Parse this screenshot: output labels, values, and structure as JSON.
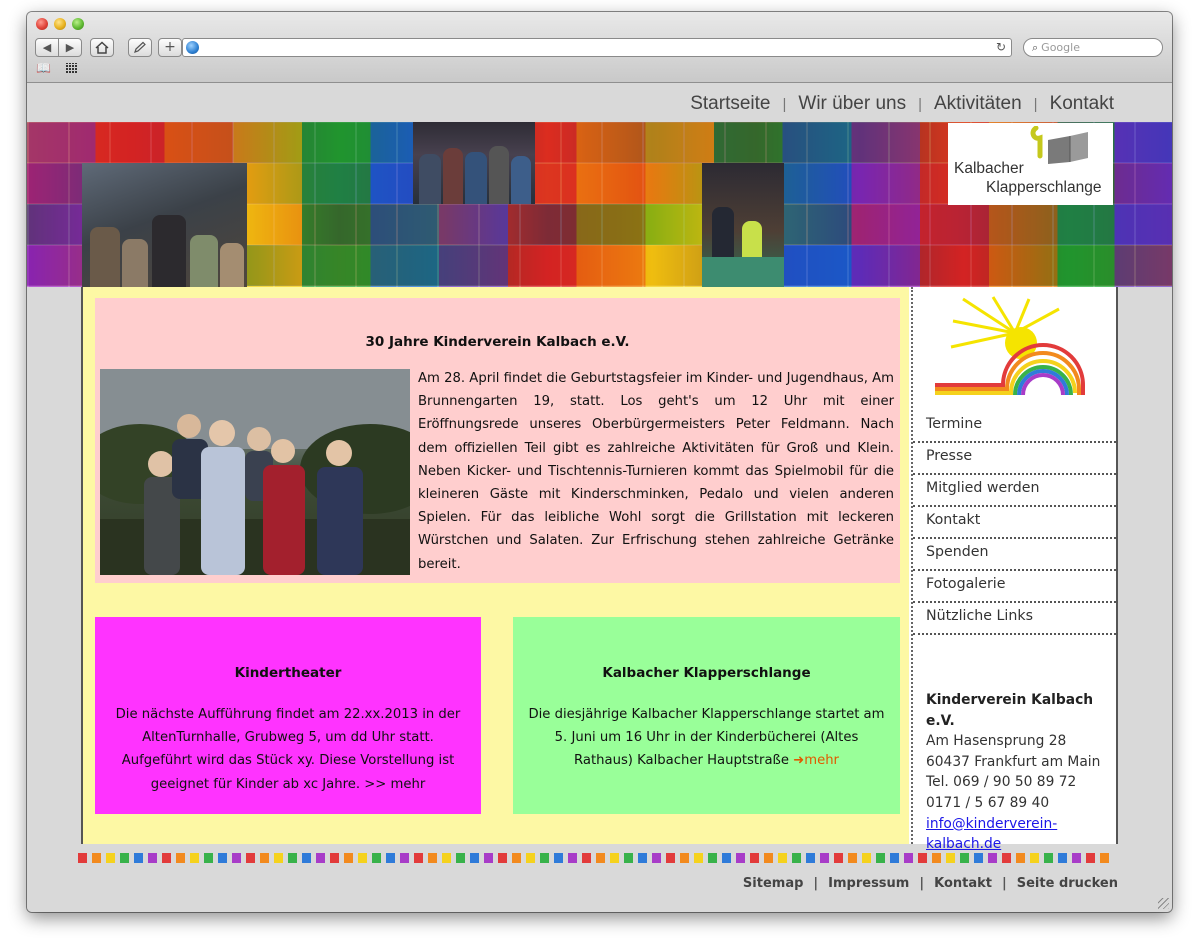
{
  "browser": {
    "url": "",
    "search_placeholder": "Google",
    "buttons": {
      "back": "◀",
      "forward": "▶",
      "add": "+"
    }
  },
  "topnav": {
    "items": [
      "Startseite",
      "Wir über uns",
      "Aktivitäten",
      "Kontakt"
    ],
    "separator": "|"
  },
  "banner": {
    "logo_line1": "Kalbacher",
    "logo_line2": "Klapperschlange"
  },
  "feature": {
    "title": "30 Jahre Kinderverein Kalbach e.V.",
    "text": "Am 28. April findet die Geburtstagsfeier im Kinder- und Jugendhaus, Am Brunnengarten 19, statt. Los geht's um 12 Uhr mit einer Eröffnungsrede unseres Oberbürgermeisters Peter Feldmann. Nach dem offiziellen Teil gibt es zahlreiche Aktivitäten für Groß und Klein. Neben Kicker- und Tischtennis-Turnieren kommt das Spielmobil für die kleineren Gäste mit Kinderschminken, Pedalo und vielen anderen Spielen. Für das leibliche Wohl sorgt die Grillstation mit leckeren Würstchen und Salaten. Zur Erfrischung stehen zahlreiche Getränke bereit."
  },
  "boxes": {
    "theater": {
      "title": "Kindertheater",
      "text": "Die nächste Aufführung findet am 22.xx.2013 in der AltenTurnhalle, Grubweg 5, um dd Uhr statt. Aufgeführt wird das Stück xy. Diese Vorstellung ist geeignet für Kinder ab xc Jahre. >> mehr",
      "color": "#ff33ff"
    },
    "snake": {
      "title": "Kalbacher Klapperschlange",
      "text": "Die diesjährige Kalbacher Klapperschlange startet am 5. Juni um 16 Uhr in der Kinderbücherei (Altes Rathaus) Kalbacher Hauptstraße",
      "more": "mehr",
      "color": "#99ff99"
    }
  },
  "sidebar": {
    "nav": [
      "Termine",
      "Presse",
      "Mitglied werden",
      "Kontakt",
      "Spenden",
      "Fotogalerie",
      "Nützliche Links"
    ],
    "address": {
      "org": "Kinderverein Kalbach e.V.",
      "street": "Am Hasensprung 28",
      "city": "60437 Frankfurt am Main",
      "tel": "Tel. 069 / 90 50 89 72",
      "mobile": "0171 / 5 67 89 40",
      "email_line1": "info@kinderverein-",
      "email_line2": "kalbach.de"
    }
  },
  "footer": {
    "links": [
      "Sitemap",
      "Impressum",
      "Kontakt",
      "Seite drucken"
    ],
    "separator": "|"
  },
  "colors": {
    "page_bg": "#d9d9d9",
    "main_bg": "#fdf8a4",
    "feature_bg": "#ffcece",
    "link": "#1b16e8",
    "more_link": "#e05a00",
    "rainbow": [
      "#e23b3b",
      "#f28a1e",
      "#f5d21d",
      "#38b24a",
      "#2f7bd9",
      "#a83cc8"
    ]
  }
}
